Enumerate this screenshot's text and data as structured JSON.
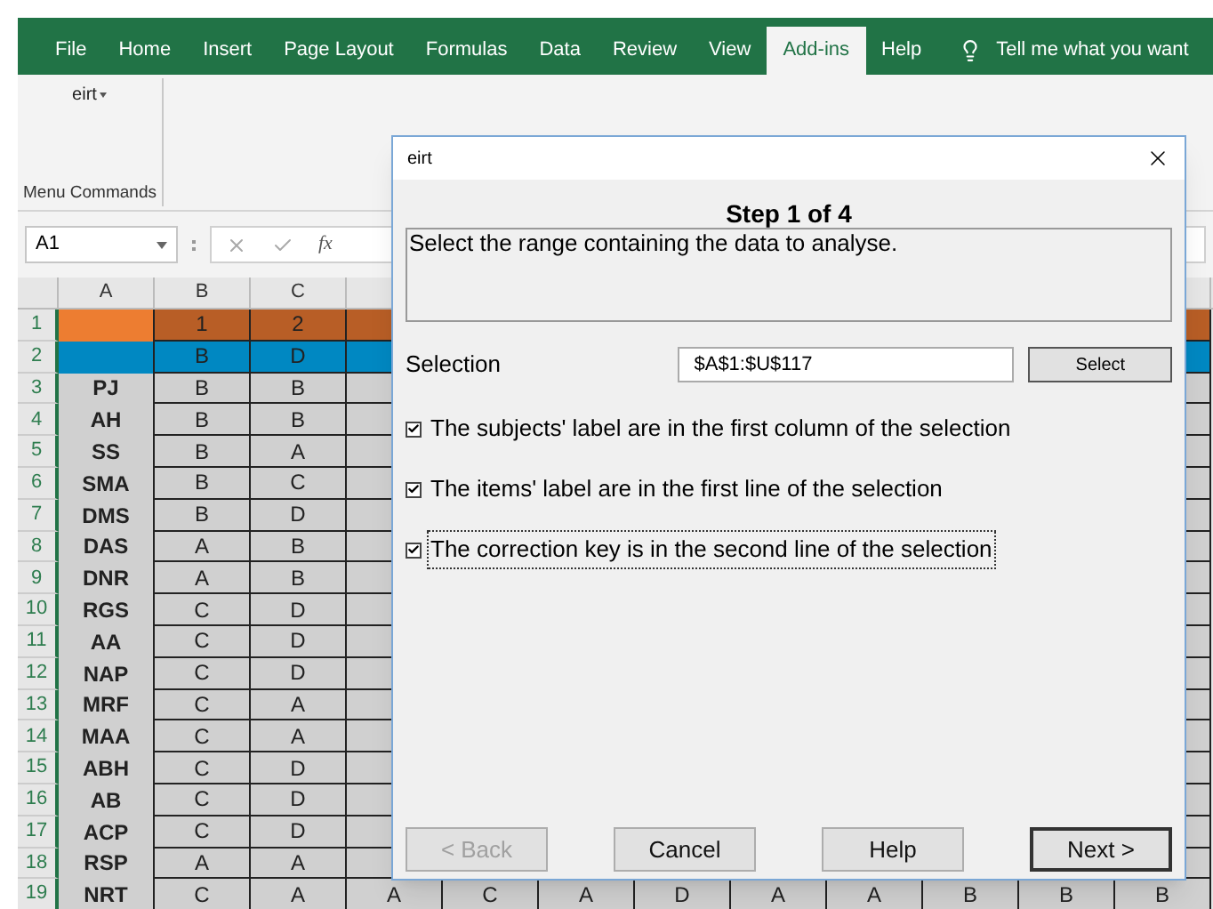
{
  "ribbon": {
    "tabs": [
      {
        "label": "File",
        "selected": false
      },
      {
        "label": "Home",
        "selected": false
      },
      {
        "label": "Insert",
        "selected": false
      },
      {
        "label": "Page Layout",
        "selected": false
      },
      {
        "label": "Formulas",
        "selected": false
      },
      {
        "label": "Data",
        "selected": false
      },
      {
        "label": "Review",
        "selected": false
      },
      {
        "label": "View",
        "selected": false
      },
      {
        "label": "Add-ins",
        "selected": true
      },
      {
        "label": "Help",
        "selected": false
      }
    ],
    "tell_me": "Tell me what you want",
    "group": {
      "button": "eirt",
      "label": "Menu Commands"
    }
  },
  "formula_bar": {
    "name_box": "A1",
    "function_label": "fx"
  },
  "sheet": {
    "columns": [
      "A",
      "B",
      "C"
    ],
    "rows": [
      {
        "number": "1",
        "kind": "items",
        "cells": [
          "",
          "1",
          "2"
        ]
      },
      {
        "number": "2",
        "kind": "key",
        "cells": [
          "",
          "B",
          "D"
        ]
      },
      {
        "number": "3",
        "kind": "subject",
        "cells": [
          "PJ",
          "B",
          "B"
        ]
      },
      {
        "number": "4",
        "kind": "subject",
        "cells": [
          "AH",
          "B",
          "B"
        ]
      },
      {
        "number": "5",
        "kind": "subject",
        "cells": [
          "SS",
          "B",
          "A"
        ]
      },
      {
        "number": "6",
        "kind": "subject",
        "cells": [
          "SMA",
          "B",
          "C"
        ]
      },
      {
        "number": "7",
        "kind": "subject",
        "cells": [
          "DMS",
          "B",
          "D"
        ]
      },
      {
        "number": "8",
        "kind": "subject",
        "cells": [
          "DAS",
          "A",
          "B"
        ]
      },
      {
        "number": "9",
        "kind": "subject",
        "cells": [
          "DNR",
          "A",
          "B"
        ]
      },
      {
        "number": "10",
        "kind": "subject",
        "cells": [
          "RGS",
          "C",
          "D"
        ]
      },
      {
        "number": "11",
        "kind": "subject",
        "cells": [
          "AA",
          "C",
          "D"
        ]
      },
      {
        "number": "12",
        "kind": "subject",
        "cells": [
          "NAP",
          "C",
          "D"
        ]
      },
      {
        "number": "13",
        "kind": "subject",
        "cells": [
          "MRF",
          "C",
          "A"
        ]
      },
      {
        "number": "14",
        "kind": "subject",
        "cells": [
          "MAA",
          "C",
          "A"
        ]
      },
      {
        "number": "15",
        "kind": "subject",
        "cells": [
          "ABH",
          "C",
          "D"
        ]
      },
      {
        "number": "16",
        "kind": "subject",
        "cells": [
          "AB",
          "C",
          "D"
        ]
      },
      {
        "number": "17",
        "kind": "subject",
        "cells": [
          "ACP",
          "C",
          "D"
        ]
      },
      {
        "number": "18",
        "kind": "subject",
        "cells": [
          "RSP",
          "A",
          "A"
        ]
      },
      {
        "number": "19",
        "kind": "subject",
        "cells": [
          "NRT",
          "C",
          "A",
          "A",
          "C",
          "A",
          "D",
          "A",
          "A",
          "B",
          "B",
          "B"
        ]
      }
    ]
  },
  "dialog": {
    "title": "eirt",
    "step": "Step 1 of 4",
    "instruction": "Select the range containing the data to analyse.",
    "selection_label": "Selection",
    "selection_value": "$A$1:$U$117",
    "select_button": "Select",
    "options": [
      {
        "label": "The subjects' label are in the first column of the selection",
        "checked": true,
        "focused": false
      },
      {
        "label": "The items' label are in the first line of the selection",
        "checked": true,
        "focused": false
      },
      {
        "label": "The correction key is in the second line of the selection",
        "checked": true,
        "focused": true
      }
    ],
    "buttons": [
      {
        "label": "< Back",
        "disabled": true,
        "default": false
      },
      {
        "label": "Cancel",
        "disabled": false,
        "default": false
      },
      {
        "label": "Help",
        "disabled": false,
        "default": false
      },
      {
        "label": "Next >",
        "disabled": false,
        "default": true
      }
    ]
  }
}
